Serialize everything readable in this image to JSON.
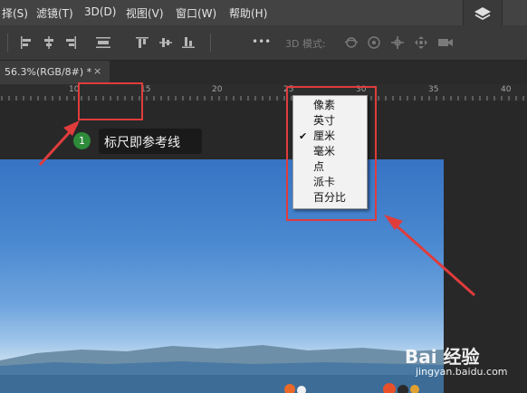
{
  "menubar": {
    "items": [
      "择(S)",
      "滤镜(T)",
      "3D(D)",
      "视图(V)",
      "窗口(W)",
      "帮助(H)"
    ]
  },
  "options_bar": {
    "mode_label": "3D 模式:",
    "more_label": "•••"
  },
  "tab": {
    "title": "56.3%(RGB/8#) *",
    "close": "×"
  },
  "ruler": {
    "labels": [
      "10",
      "15",
      "20",
      "25",
      "30",
      "35",
      "40"
    ]
  },
  "callout": {
    "badge_number": "1",
    "text": "标尺即参考线"
  },
  "context_menu": {
    "checked_index": 2,
    "check_mark": "✔",
    "items": [
      "像素",
      "英寸",
      "厘米",
      "毫米",
      "点",
      "派卡",
      "百分比"
    ]
  },
  "watermark": {
    "logo_text": "Bai 经验",
    "url": "jingyan.baidu.com"
  },
  "colors": {
    "accent_red": "#e03c3c",
    "badge_green": "#2e8b3a",
    "menubar_bg": "#434343"
  }
}
